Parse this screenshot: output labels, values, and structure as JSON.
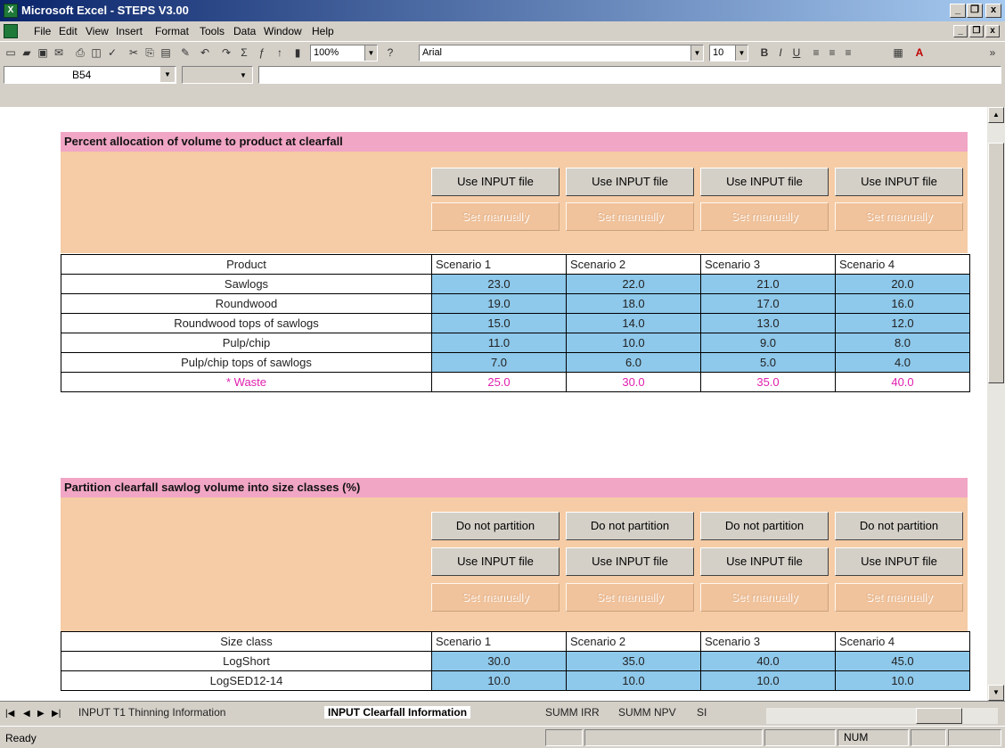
{
  "window": {
    "title": "Microsoft Excel - STEPS V3.00",
    "app_icon_text": "X",
    "min": "_",
    "restore": "❐",
    "close": "x"
  },
  "menubar": {
    "items": [
      "File",
      "Edit",
      "View",
      "Insert",
      "Format",
      "Tools",
      "Data",
      "Window",
      "Help"
    ],
    "min": "_",
    "restore": "❐",
    "close": "x"
  },
  "toolbar": {
    "zoom": "100%",
    "font": "Arial",
    "font_size": "10",
    "bold": "B",
    "italic": "I",
    "underline": "U"
  },
  "formula_bar": {
    "cell_ref": "B54"
  },
  "section1": {
    "title": "Percent allocation of volume to product at clearfall",
    "buttons_input": [
      "Use INPUT file",
      "Use INPUT file",
      "Use INPUT file",
      "Use INPUT file"
    ],
    "buttons_manual": [
      "Set manually",
      "Set manually",
      "Set manually",
      "Set manually"
    ],
    "header": [
      "Product",
      "Scenario 1",
      "Scenario 2",
      "Scenario 3",
      "Scenario 4"
    ],
    "rows": [
      {
        "label": "Sawlogs",
        "values": [
          "23.0",
          "22.0",
          "21.0",
          "20.0"
        ]
      },
      {
        "label": "Roundwood",
        "values": [
          "19.0",
          "18.0",
          "17.0",
          "16.0"
        ]
      },
      {
        "label": "Roundwood tops of sawlogs",
        "values": [
          "15.0",
          "14.0",
          "13.0",
          "12.0"
        ]
      },
      {
        "label": "Pulp/chip",
        "values": [
          "11.0",
          "10.0",
          "9.0",
          "8.0"
        ]
      },
      {
        "label": "Pulp/chip tops of sawlogs",
        "values": [
          "7.0",
          "6.0",
          "5.0",
          "4.0"
        ]
      }
    ],
    "waste": {
      "label": "* Waste",
      "values": [
        "25.0",
        "30.0",
        "35.0",
        "40.0"
      ]
    }
  },
  "section2": {
    "title": "Partition clearfall sawlog volume into size classes (%)",
    "buttons_partition": [
      "Do not partition",
      "Do not partition",
      "Do not partition",
      "Do not partition"
    ],
    "buttons_input": [
      "Use INPUT file",
      "Use INPUT file",
      "Use INPUT file",
      "Use INPUT file"
    ],
    "buttons_manual": [
      "Set manually",
      "Set manually",
      "Set manually",
      "Set manually"
    ],
    "header": [
      "Size class",
      "Scenario 1",
      "Scenario 2",
      "Scenario 3",
      "Scenario 4"
    ],
    "rows": [
      {
        "label": "LogShort",
        "values": [
          "30.0",
          "35.0",
          "40.0",
          "45.0"
        ]
      },
      {
        "label": "LogSED12-14",
        "values": [
          "10.0",
          "10.0",
          "10.0",
          "10.0"
        ]
      }
    ]
  },
  "sheet_tabs": {
    "tabs": [
      "INPUT T1 Thinning Information",
      "INPUT Clearfall Information",
      "SUMM IRR",
      "SUMM NPV",
      "SI"
    ],
    "active": "INPUT Clearfall Information"
  },
  "status": {
    "text": "Ready",
    "num": "NUM"
  },
  "colors": {
    "banner": "#f1a6c5",
    "panel": "#f5cca6",
    "value_cell": "#8ec8ea",
    "waste_text": "#e020b0"
  }
}
